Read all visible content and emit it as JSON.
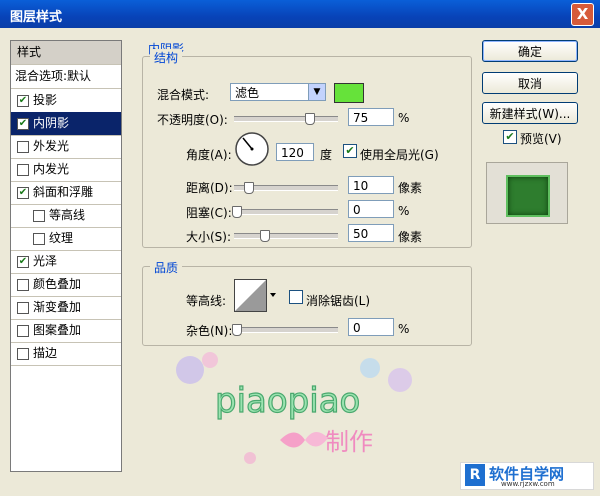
{
  "window": {
    "title": "图层样式",
    "close_label": "X"
  },
  "left_panel": {
    "header": "样式",
    "blend_default": "混合选项:默认",
    "items": [
      {
        "label": "投影",
        "checked": true
      },
      {
        "label": "内阴影",
        "checked": true,
        "selected": true
      },
      {
        "label": "外发光",
        "checked": false
      },
      {
        "label": "内发光",
        "checked": false
      },
      {
        "label": "斜面和浮雕",
        "checked": true
      },
      {
        "label": "等高线",
        "checked": false,
        "sub": true
      },
      {
        "label": "纹理",
        "checked": false,
        "sub": true
      },
      {
        "label": "光泽",
        "checked": true
      },
      {
        "label": "颜色叠加",
        "checked": false
      },
      {
        "label": "渐变叠加",
        "checked": false
      },
      {
        "label": "图案叠加",
        "checked": false
      },
      {
        "label": "描边",
        "checked": false
      }
    ]
  },
  "inner_shadow": {
    "section_title": "内阴影",
    "structure_title": "结构",
    "blend_mode_label": "混合模式:",
    "blend_mode_value": "滤色",
    "swatch_color": "#66e23a",
    "opacity_label": "不透明度(O):",
    "opacity_value": "75",
    "opacity_pct": 0.75,
    "percent_unit": "%",
    "angle_label": "角度(A):",
    "angle_value": "120",
    "angle_unit": "度",
    "global_light_label": "使用全局光(G)",
    "global_light_checked": true,
    "distance_label": "距离(D):",
    "distance_value": "10",
    "pixels_unit": "像素",
    "choke_label": "阻塞(C):",
    "choke_value": "0",
    "size_label": "大小(S):",
    "size_value": "50",
    "quality_title": "品质",
    "contour_label": "等高线:",
    "antialias_label": "消除锯齿(L)",
    "noise_label": "杂色(N):",
    "noise_value": "0"
  },
  "buttons": {
    "ok": "确定",
    "cancel": "取消",
    "new_style": "新建样式(W)...",
    "preview_label": "预览(V)"
  },
  "watermark": {
    "text": "piaopiao",
    "sub": "制作"
  },
  "corner_logo": {
    "text": "软件自学网",
    "url": "www.rjzxw.com"
  },
  "colors": {
    "accent": "#0046d5",
    "swatch": "#66e23a",
    "selected_bg": "#0a246a"
  }
}
